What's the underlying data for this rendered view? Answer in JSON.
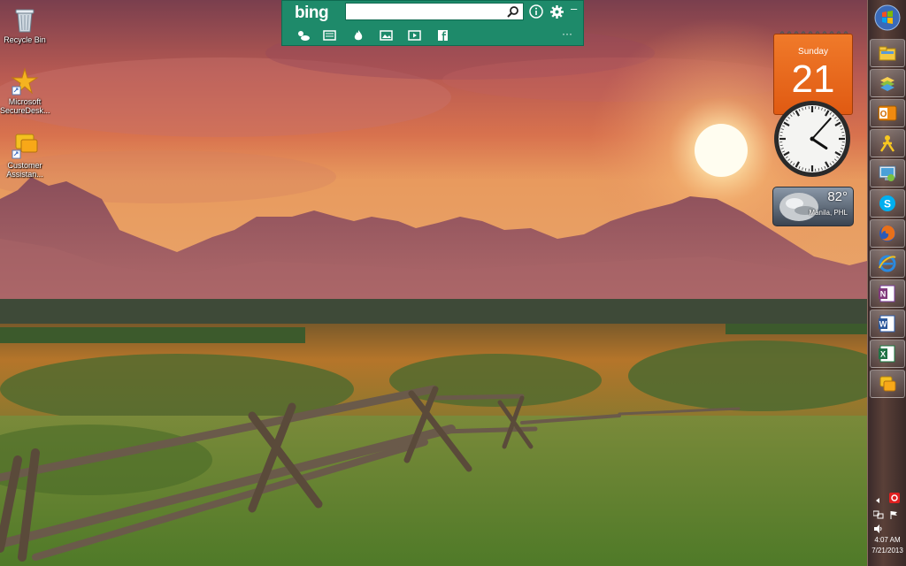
{
  "desktop": {
    "icons": [
      {
        "name": "recycle-bin",
        "label": "Recycle Bin"
      },
      {
        "name": "microsoft-securedesk",
        "label": "Microsoft SecureDesk..."
      },
      {
        "name": "customer-assistant",
        "label": "Customer Assistan..."
      }
    ]
  },
  "bing_bar": {
    "logo": "bing",
    "search_value": "",
    "search_placeholder": "",
    "minimize_label": "–",
    "more_label": "···",
    "tools": [
      "weather-icon",
      "news-icon",
      "hot-icon",
      "images-icon",
      "video-icon",
      "facebook-icon"
    ],
    "brand_color": "#1e8a6a"
  },
  "gadgets": {
    "calendar": {
      "weekday": "Sunday",
      "day": "21"
    },
    "clock": {
      "hour": 4,
      "minute": 7
    },
    "weather": {
      "temperature": "82°",
      "location": "Manila, PHL"
    }
  },
  "taskbar": {
    "apps": [
      "windows-explorer-icon",
      "windows-live-icon",
      "outlook-icon",
      "aim-icon",
      "remote-desktop-icon",
      "skype-icon",
      "firefox-icon",
      "internet-explorer-icon",
      "onenote-icon",
      "word-icon",
      "excel-icon",
      "customer-assistant-icon"
    ],
    "time": "4:07 AM",
    "date": "7/21/2013"
  }
}
